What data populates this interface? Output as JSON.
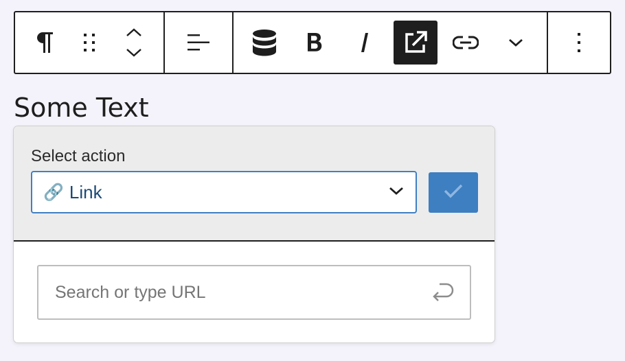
{
  "toolbar": {
    "groups": [
      [
        "paragraph-icon",
        "drag-handle-icon",
        "move-up-down-icon"
      ],
      [
        "align-left-icon"
      ],
      [
        "database-icon",
        "bold-icon",
        "italic-icon",
        "external-link-icon",
        "link-icon",
        "chevron-down-icon"
      ],
      [
        "more-options-icon"
      ]
    ],
    "active_button": "external-link-icon"
  },
  "block": {
    "text": "Some Text"
  },
  "popover": {
    "select_label": "Select action",
    "select_value": "Link",
    "select_icon": "link-emoji",
    "confirm_icon": "checkmark-icon",
    "url_placeholder": "Search or type URL",
    "url_value": "",
    "submit_icon": "enter-return-icon"
  },
  "colors": {
    "accent": "#3d7fc1",
    "toolbar_border": "#1e1e1e",
    "popover_header_bg": "#ececec",
    "page_bg": "#f4f3fb"
  }
}
